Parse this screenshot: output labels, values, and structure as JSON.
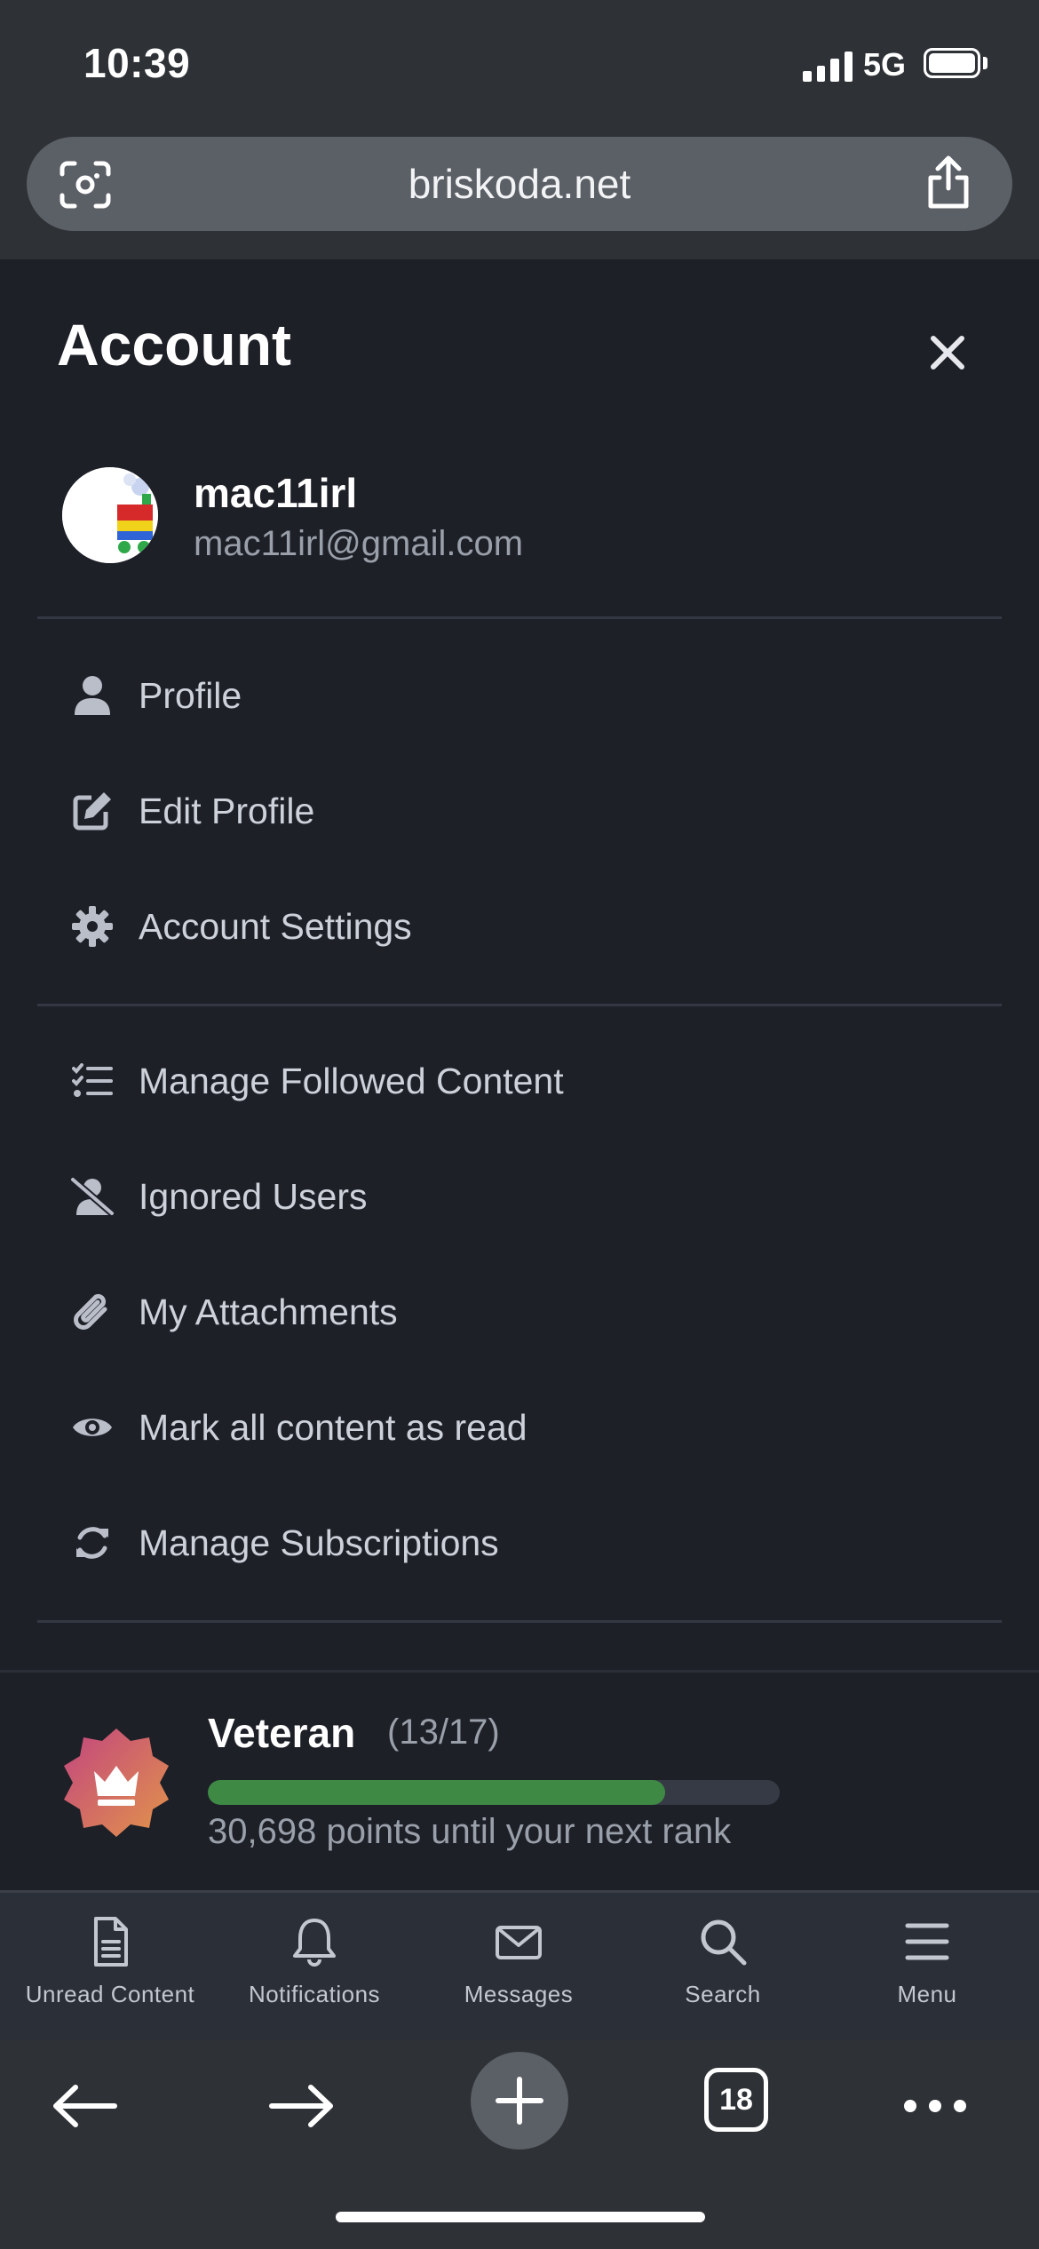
{
  "status_bar": {
    "time": "10:39",
    "network": "5G"
  },
  "browser": {
    "url": "briskoda.net",
    "open_tabs": "18"
  },
  "drawer": {
    "title": "Account",
    "user": {
      "name": "mac11irl",
      "email": "mac11irl@gmail.com"
    },
    "menu_group_1": [
      {
        "label": "Profile",
        "icon": "user-icon"
      },
      {
        "label": "Edit Profile",
        "icon": "edit-icon"
      },
      {
        "label": "Account Settings",
        "icon": "gear-icon"
      }
    ],
    "menu_group_2": [
      {
        "label": "Manage Followed Content",
        "icon": "checklist-icon"
      },
      {
        "label": "Ignored Users",
        "icon": "user-slash-icon"
      },
      {
        "label": "My Attachments",
        "icon": "paperclip-icon"
      },
      {
        "label": "Mark all content as read",
        "icon": "eye-icon"
      },
      {
        "label": "Manage Subscriptions",
        "icon": "refresh-icon"
      }
    ],
    "rank": {
      "name": "Veteran",
      "count": "(13/17)",
      "progress": 0.8,
      "next": "30,698 points until your next rank",
      "badge_colors": [
        "#c2457f",
        "#e2944a"
      ],
      "progress_color": "#3e8a45"
    }
  },
  "tab_bar": [
    {
      "label": "Unread Content",
      "icon": "document-icon"
    },
    {
      "label": "Notifications",
      "icon": "bell-icon"
    },
    {
      "label": "Messages",
      "icon": "envelope-icon"
    },
    {
      "label": "Search",
      "icon": "search-icon"
    },
    {
      "label": "Menu",
      "icon": "menu-icon"
    }
  ]
}
